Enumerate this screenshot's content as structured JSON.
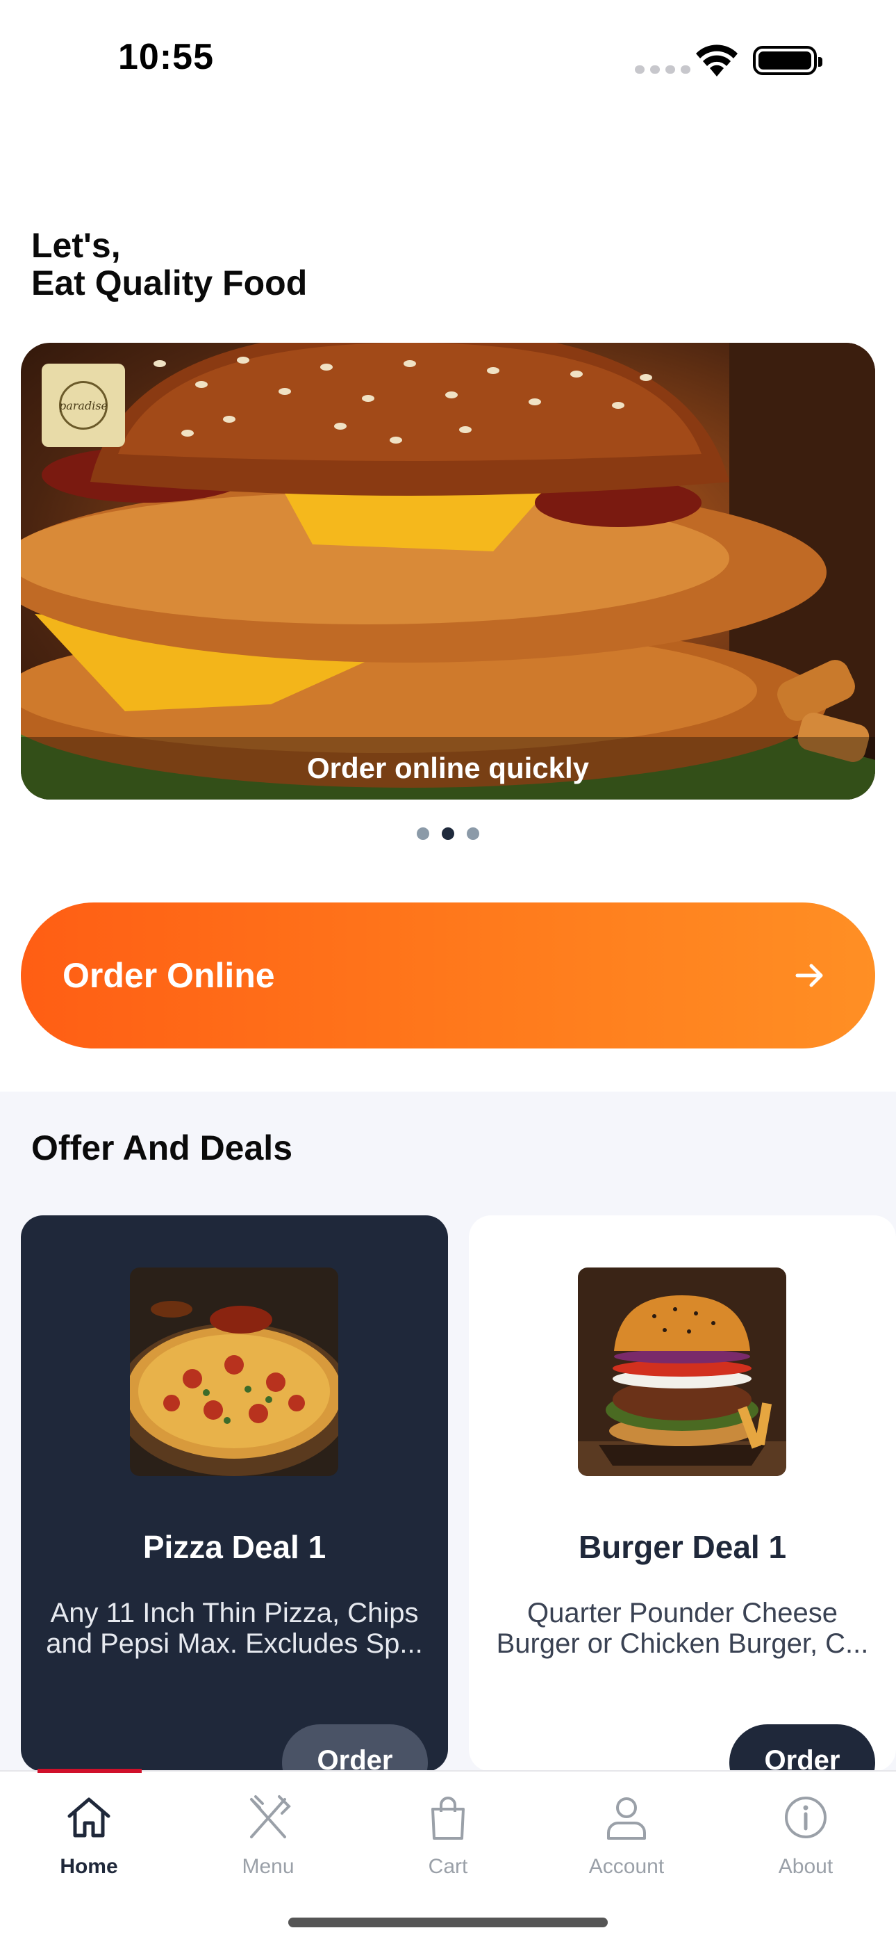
{
  "status_bar": {
    "time": "10:55"
  },
  "greeting": {
    "line1": "Let's,",
    "line2": "Eat Quality Food"
  },
  "hero": {
    "logo_icon": "paradise-logo",
    "caption": "Order online quickly",
    "slides_count": 3,
    "active_slide": 2
  },
  "order_button": {
    "label": "Order Online",
    "icon": "arrow-right-icon",
    "color_start": "#ff5e14",
    "color_end": "#ff8f24"
  },
  "offers": {
    "title": "Offer And Deals",
    "cards": [
      {
        "title": "Pizza Deal 1",
        "description": "Any 11 Inch Thin Pizza, Chips and Pepsi Max. Excludes Sp...",
        "button": "Order",
        "theme": "dark"
      },
      {
        "title": "Burger Deal 1",
        "description": "Quarter Pounder Cheese Burger or Chicken Burger, C...",
        "button": "Order",
        "theme": "light"
      }
    ]
  },
  "tabbar": {
    "active": "Home",
    "accent_color": "#d0102a",
    "tabs": [
      {
        "label": "Home",
        "icon": "home-icon"
      },
      {
        "label": "Menu",
        "icon": "fork-knife-icon"
      },
      {
        "label": "Cart",
        "icon": "shopping-bag-icon"
      },
      {
        "label": "Account",
        "icon": "user-icon"
      },
      {
        "label": "About",
        "icon": "info-icon"
      }
    ]
  }
}
